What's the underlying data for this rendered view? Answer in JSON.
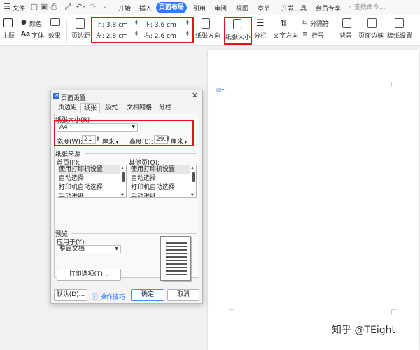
{
  "menubar": {
    "file_label": "文件",
    "tabs": [
      "开始",
      "插入",
      "页面布局",
      "引用",
      "审阅",
      "视图",
      "章节",
      "开发工具",
      "会员专享"
    ],
    "active_tab": "页面布局",
    "search_placeholder": "查找命令..."
  },
  "ribbon": {
    "theme": "主题",
    "color": "颜色",
    "font": "字体",
    "effect": "效果",
    "margins": "页边距",
    "margin_top": "上: 3.8 cm",
    "margin_bottom": "下: 3.6 cm",
    "margin_left": "左: 2.8 cm",
    "margin_right": "右: 2.6 cm",
    "orientation": "纸张方向",
    "paper_size": "纸张大小",
    "columns": "分栏",
    "text_direction": "文字方向",
    "separator": "分隔符",
    "line_number": "行号",
    "background": "背景",
    "page_border": "页面边框",
    "paper_setup": "稿纸设置"
  },
  "dialog": {
    "title": "页面设置",
    "logo": "W",
    "tabs": [
      "页边距",
      "纸张",
      "版式",
      "文档网格",
      "分栏"
    ],
    "active_tab": "纸张",
    "paper_size_label": "纸张大小(R)",
    "paper_size_value": "A4",
    "width_label": "宽度(W):",
    "width_value": "21",
    "width_unit": "厘米",
    "height_label": "高度(E):",
    "height_value": "29.7",
    "height_unit": "厘米",
    "source_label": "纸张来源",
    "first_page_label": "首页(F):",
    "other_pages_label": "其他页(O):",
    "first_page_items": [
      "使用打印机设置",
      "自动选择",
      "打印机自动选择",
      "手动进纸"
    ],
    "other_pages_items": [
      "使用打印机设置",
      "自动选择",
      "打印机自动选择",
      "手动进纸"
    ],
    "preview_label": "预览",
    "apply_to_label": "应用于(Y):",
    "apply_to_value": "整篇文档",
    "print_options_button": "打印选项(T)...",
    "default_button": "默认(D)...",
    "tips_link": "操作技巧",
    "ok_button": "确定",
    "cancel_button": "取消"
  },
  "watermark": "知乎 @TEight",
  "colors": {
    "accent": "#2e7cf6",
    "highlight_box": "#e2141a"
  }
}
